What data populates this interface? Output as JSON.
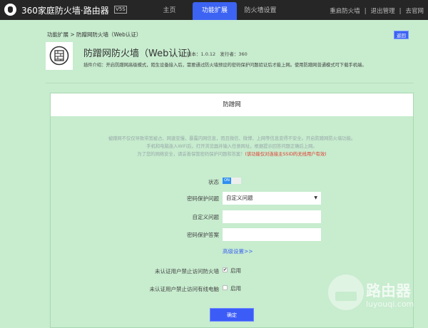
{
  "header": {
    "brand": "360家庭防火墙·路由器",
    "version_badge": "V5S",
    "tabs": [
      {
        "label": "主页"
      },
      {
        "label": "功能扩展"
      },
      {
        "label": "防火墙设置"
      }
    ],
    "links": [
      "重启防火墙",
      "退出管理",
      "去官网"
    ]
  },
  "breadcrumb": "功能扩展 > 防蹭网防火墙（Web认证）",
  "back_label": "返回",
  "plugin": {
    "title": "防蹭网防火墙（Web认证）",
    "version": "版本：1.0.12",
    "publisher": "发行者：360",
    "desc": "插件介绍：开启防蹭网高级模式，陌生设备接入后，需要通过防火墙预设的密码保护问题验证后才能上网。使用防蹭网普通模式可下载手机端。"
  },
  "card": {
    "title": "防蹭网",
    "intro": [
      "被蹭网不仅仅导致带宽被占、网速变慢，暴露内网信息，而且微信、微博、上网等信息变得不安全。开启防蹭网防火墙功能。",
      "手机和电脑连入WiFi后，打开浏览器并输入任意网址，根据提示回答问题正确后上网。",
      "为了您的网络安全，请妥善保管密码保护问题和答案！"
    ],
    "intro_warning": "(该功能仅对连接主SSID的无线用户有效)",
    "form": {
      "status_label": "状态",
      "status_value": "ON",
      "question_label": "密码保护问题",
      "question_value": "自定义问题",
      "custom_label": "自定义问题",
      "custom_value": "",
      "answer_label": "密码保护答案",
      "answer_value": "",
      "advanced_link": "高级设置>>",
      "block_fw_label": "未认证用户禁止访问防火墙",
      "block_fw_checked": true,
      "block_wired_label": "未认证用户禁止访问有线电脑",
      "block_wired_checked": false,
      "enable_label": "启用",
      "submit": "确定"
    }
  },
  "watermark": {
    "title": "路由器",
    "url": "luyouqi.com"
  }
}
